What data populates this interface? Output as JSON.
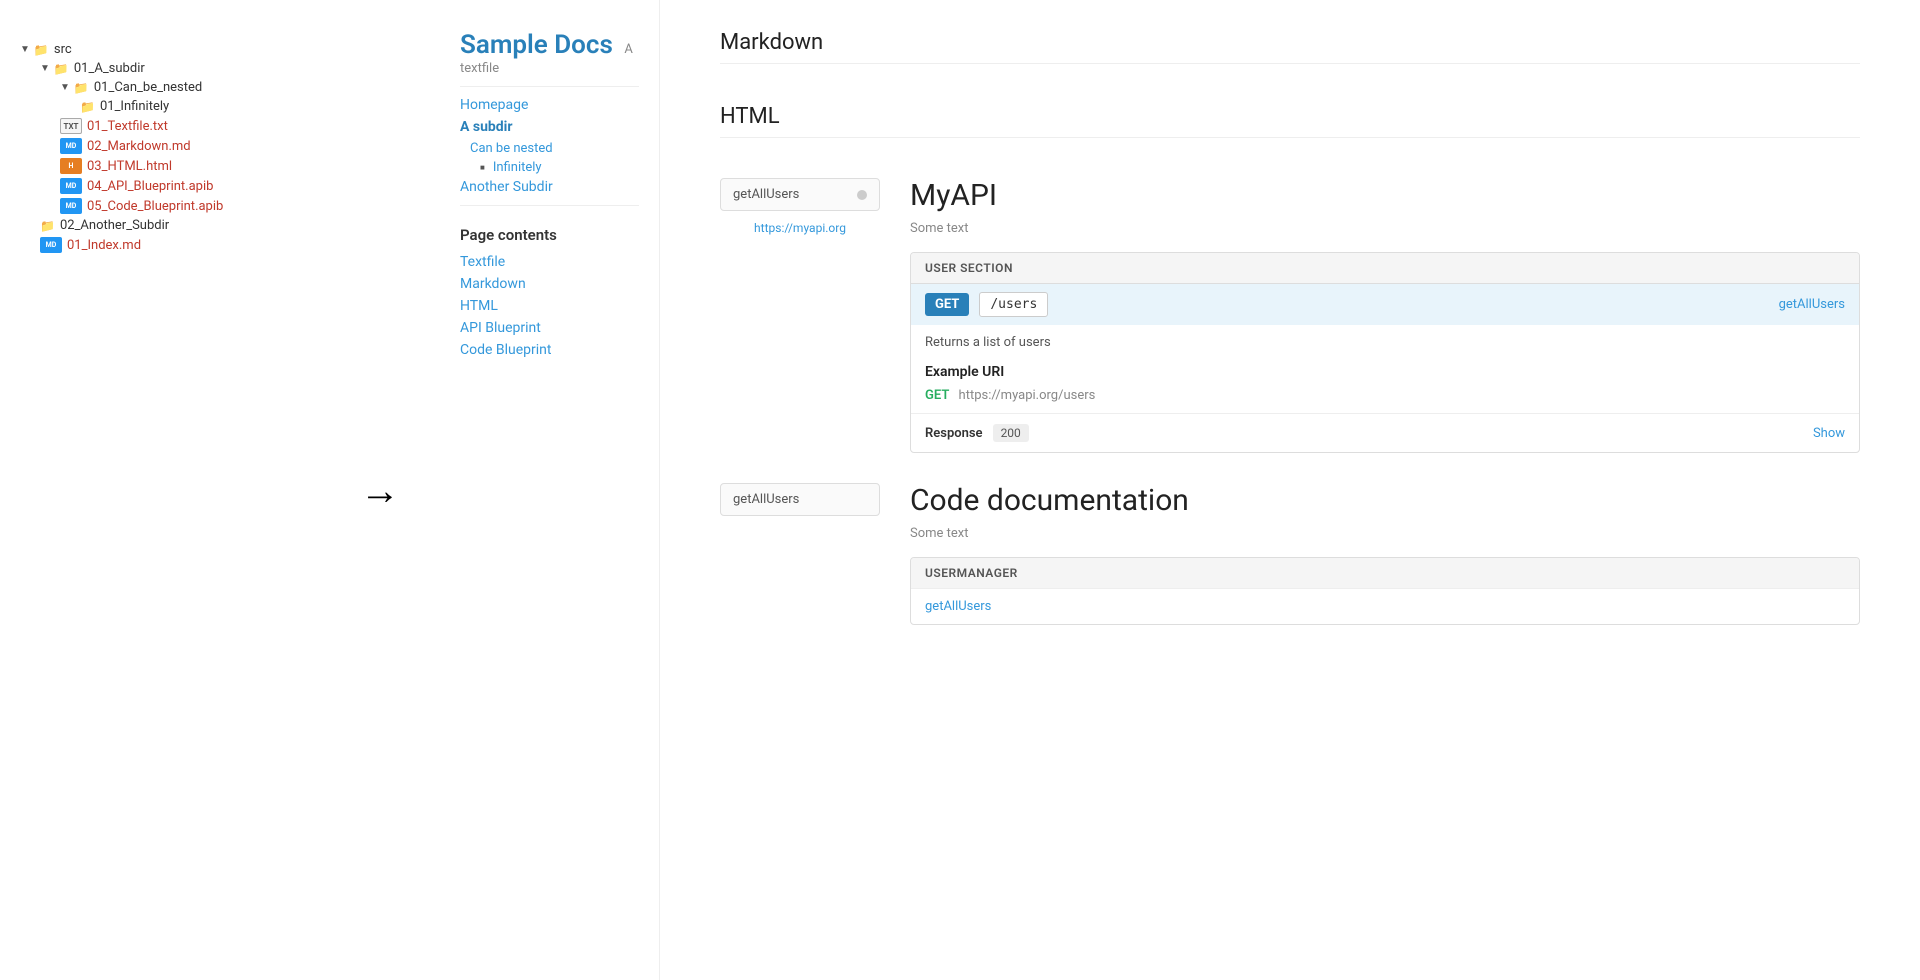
{
  "fileTree": {
    "root": {
      "name": "src",
      "children": [
        {
          "name": "01_A_subdir",
          "type": "folder",
          "children": [
            {
              "name": "01_Can_be_nested",
              "type": "folder",
              "children": [
                {
                  "name": "01_Infinitely",
                  "type": "folder",
                  "children": []
                }
              ]
            },
            {
              "name": "01_Textfile.txt",
              "type": "txt"
            },
            {
              "name": "02_Markdown.md",
              "type": "md"
            },
            {
              "name": "03_HTML.html",
              "type": "html"
            },
            {
              "name": "04_API_Blueprint.apib",
              "type": "apib"
            },
            {
              "name": "05_Code_Blueprint.apib",
              "type": "apib"
            }
          ]
        },
        {
          "name": "02_Another_Subdir",
          "type": "folder",
          "children": []
        },
        {
          "name": "01_Index.md",
          "type": "md"
        }
      ]
    }
  },
  "nav": {
    "siteTitle": "Sample Docs",
    "siteSubtitle": "A textfile",
    "homepage": "Homepage",
    "aSubdir": "A subdir",
    "canBeNested": "Can be nested",
    "infinitely": "Infinitely",
    "anotherSubdir": "Another Subdir",
    "pageContents": "Page contents",
    "contentLinks": [
      "Textfile",
      "Markdown",
      "HTML",
      "API Blueprint",
      "Code Blueprint"
    ]
  },
  "content": {
    "sections": [
      {
        "id": "textfile",
        "heading": "Markdown"
      },
      {
        "id": "html",
        "heading": "HTML"
      }
    ],
    "api": {
      "selectorLabel": "getAllUsers",
      "apiUrl": "https://myapi.org",
      "title": "MyAPI",
      "someText": "Some text",
      "userSection": {
        "header": "USER SECTION",
        "method": "GET",
        "path": "/users",
        "operationId": "getAllUsers",
        "description": "Returns a list of users",
        "exampleUri": {
          "title": "Example URI",
          "method": "GET",
          "url": "https://myapi.org/users"
        },
        "response": {
          "label": "Response",
          "code": "200",
          "show": "Show"
        }
      }
    },
    "codeDoc": {
      "selectorLabel": "getAllUsers",
      "title": "Code documentation",
      "someText": "Some text",
      "usermanager": {
        "header": "USERMANAGER",
        "link": "getAllUsers"
      }
    }
  }
}
